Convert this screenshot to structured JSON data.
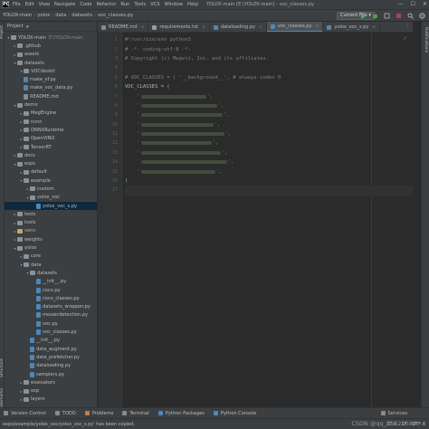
{
  "menubar": {
    "app_icon_text": "PC",
    "items": [
      "File",
      "Edit",
      "View",
      "Navigate",
      "Code",
      "Refactor",
      "Run",
      "Tools",
      "VCS",
      "Window",
      "Help"
    ],
    "title": "YOLOX-main [E:\\YOLOX-main] - voc_classes.py",
    "window_controls": [
      "—",
      "☐",
      "✕"
    ]
  },
  "navbar": {
    "crumbs": [
      "YOLOX-main",
      "yolox",
      "data",
      "datasets",
      "voc_classes.py"
    ],
    "run_config": "Current File ▾"
  },
  "left_strip": {
    "top_label": "Project",
    "structure_label": "Structure",
    "bookmarks_label": "Bookmarks"
  },
  "right_strip": {
    "label": "Notifications"
  },
  "project_panel": {
    "title": "Project",
    "tree": [
      {
        "depth": 0,
        "arrow": "▾",
        "icon": "folder",
        "label": "YOLOX-main",
        "extra": "E:\\YOLOX-main"
      },
      {
        "depth": 1,
        "arrow": "▸",
        "icon": "folder",
        "label": ".github"
      },
      {
        "depth": 1,
        "arrow": "▸",
        "icon": "folder",
        "label": "assets"
      },
      {
        "depth": 1,
        "arrow": "▾",
        "icon": "folder",
        "label": "datasets"
      },
      {
        "depth": 2,
        "arrow": "▾",
        "icon": "folder",
        "label": "VOCdevkit"
      },
      {
        "depth": 2,
        "arrow": "",
        "icon": "py",
        "label": "make_xf.py"
      },
      {
        "depth": 2,
        "arrow": "",
        "icon": "py",
        "label": "make_voc_data.py"
      },
      {
        "depth": 2,
        "arrow": "",
        "icon": "md",
        "label": "README.md"
      },
      {
        "depth": 1,
        "arrow": "▾",
        "icon": "folder",
        "label": "demo"
      },
      {
        "depth": 2,
        "arrow": "▸",
        "icon": "folder",
        "label": "MegEngine"
      },
      {
        "depth": 2,
        "arrow": "▸",
        "icon": "folder",
        "label": "ncnn"
      },
      {
        "depth": 2,
        "arrow": "▸",
        "icon": "folder",
        "label": "ONNXRuntime"
      },
      {
        "depth": 2,
        "arrow": "▸",
        "icon": "folder",
        "label": "OpenVINO"
      },
      {
        "depth": 2,
        "arrow": "▸",
        "icon": "folder",
        "label": "TensorRT"
      },
      {
        "depth": 1,
        "arrow": "▸",
        "icon": "folder",
        "label": "docs"
      },
      {
        "depth": 1,
        "arrow": "▾",
        "icon": "folder",
        "label": "exps"
      },
      {
        "depth": 2,
        "arrow": "▸",
        "icon": "folder",
        "label": "default"
      },
      {
        "depth": 2,
        "arrow": "▾",
        "icon": "folder",
        "label": "example"
      },
      {
        "depth": 3,
        "arrow": "▸",
        "icon": "folder",
        "label": "custom"
      },
      {
        "depth": 3,
        "arrow": "▾",
        "icon": "folder",
        "label": "yolox_voc"
      },
      {
        "depth": 4,
        "arrow": "",
        "icon": "py",
        "label": "yolox_voc_s.py",
        "selected": true
      },
      {
        "depth": 1,
        "arrow": "▸",
        "icon": "folder",
        "label": "tests"
      },
      {
        "depth": 1,
        "arrow": "▸",
        "icon": "folder",
        "label": "tools"
      },
      {
        "depth": 1,
        "arrow": "▸",
        "icon": "venv",
        "label": "venv"
      },
      {
        "depth": 1,
        "arrow": "▸",
        "icon": "folder",
        "label": "weights"
      },
      {
        "depth": 1,
        "arrow": "▾",
        "icon": "folder",
        "label": "yolox"
      },
      {
        "depth": 2,
        "arrow": "▸",
        "icon": "folder",
        "label": "core"
      },
      {
        "depth": 2,
        "arrow": "▾",
        "icon": "folder",
        "label": "data"
      },
      {
        "depth": 3,
        "arrow": "▾",
        "icon": "folder",
        "label": "datasets"
      },
      {
        "depth": 4,
        "arrow": "",
        "icon": "py",
        "label": "__init__.py"
      },
      {
        "depth": 4,
        "arrow": "",
        "icon": "py",
        "label": "coco.py"
      },
      {
        "depth": 4,
        "arrow": "",
        "icon": "py",
        "label": "coco_classes.py"
      },
      {
        "depth": 4,
        "arrow": "",
        "icon": "py",
        "label": "datasets_wrapper.py"
      },
      {
        "depth": 4,
        "arrow": "",
        "icon": "py",
        "label": "mosaicdetection.py"
      },
      {
        "depth": 4,
        "arrow": "",
        "icon": "py",
        "label": "voc.py"
      },
      {
        "depth": 4,
        "arrow": "",
        "icon": "py",
        "label": "voc_classes.py"
      },
      {
        "depth": 3,
        "arrow": "",
        "icon": "py",
        "label": "__init__.py"
      },
      {
        "depth": 3,
        "arrow": "",
        "icon": "py",
        "label": "data_augment.py"
      },
      {
        "depth": 3,
        "arrow": "",
        "icon": "py",
        "label": "data_prefetcher.py"
      },
      {
        "depth": 3,
        "arrow": "",
        "icon": "py",
        "label": "dataloading.py"
      },
      {
        "depth": 3,
        "arrow": "",
        "icon": "py",
        "label": "samplers.py"
      },
      {
        "depth": 2,
        "arrow": "▸",
        "icon": "folder",
        "label": "evaluators"
      },
      {
        "depth": 2,
        "arrow": "▸",
        "icon": "folder",
        "label": "exp"
      },
      {
        "depth": 2,
        "arrow": "▸",
        "icon": "folder",
        "label": "layers"
      }
    ]
  },
  "editor_tabs": [
    {
      "label": "README.md",
      "icon_color": "#7d8d99",
      "active": false
    },
    {
      "label": "requirements.txt",
      "icon_color": "#9a9a9a",
      "active": false
    },
    {
      "label": "dataloading.py",
      "icon_color": "#4e87b8",
      "active": false
    },
    {
      "label": "voc_classes.py",
      "icon_color": "#4e87b8",
      "active": true
    },
    {
      "label": "yolox_voc_s.py",
      "icon_color": "#4e87b8",
      "active": false
    }
  ],
  "editor": {
    "lines": [
      {
        "n": "1",
        "text": "#!/usr/bin/env python3",
        "kind": "comment"
      },
      {
        "n": "2",
        "text": "# -*- coding:utf-8 -*-",
        "kind": "comment"
      },
      {
        "n": "3",
        "text": "# Copyright (c) Megvii, Inc. and its affiliates.",
        "kind": "comment"
      },
      {
        "n": "4",
        "text": "",
        "kind": "blank"
      },
      {
        "n": "5",
        "text": "# VOC_CLASSES = ( '__background__', # always index 0",
        "kind": "comment"
      },
      {
        "n": "6",
        "text": "VOC_CLASSES = (",
        "kind": "ident"
      },
      {
        "n": "7",
        "text": "",
        "kind": "blurred",
        "w": 72
      },
      {
        "n": "8",
        "text": "",
        "kind": "blurred",
        "w": 84
      },
      {
        "n": "9",
        "text": "",
        "kind": "blurred",
        "w": 90
      },
      {
        "n": "10",
        "text": "",
        "kind": "blurred",
        "w": 80
      },
      {
        "n": "11",
        "text": "",
        "kind": "blurred",
        "w": 92
      },
      {
        "n": "12",
        "text": "",
        "kind": "blurred",
        "w": 78
      },
      {
        "n": "13",
        "text": "",
        "kind": "blurred",
        "w": 88
      },
      {
        "n": "14",
        "text": "",
        "kind": "blurred",
        "w": 95
      },
      {
        "n": "15",
        "text": "",
        "kind": "blurred",
        "w": 82
      },
      {
        "n": "16",
        "text": ")",
        "kind": "ident"
      },
      {
        "n": "17",
        "text": "",
        "kind": "current"
      }
    ]
  },
  "bottom_tools": [
    {
      "label": "Version Control"
    },
    {
      "label": "TODO"
    },
    {
      "label": "Problems"
    },
    {
      "label": "Terminal"
    },
    {
      "label": "Python Packages"
    },
    {
      "label": "Python Console"
    },
    {
      "label": "Services"
    }
  ],
  "statusbar": {
    "message": "exps/example/yolox_voc/yolox_voc_s.py' has been copied.",
    "position": "17:1",
    "line_sep": "LF",
    "encoding": "UTF-8",
    "watermark": "CSDN @qq_35621580"
  }
}
